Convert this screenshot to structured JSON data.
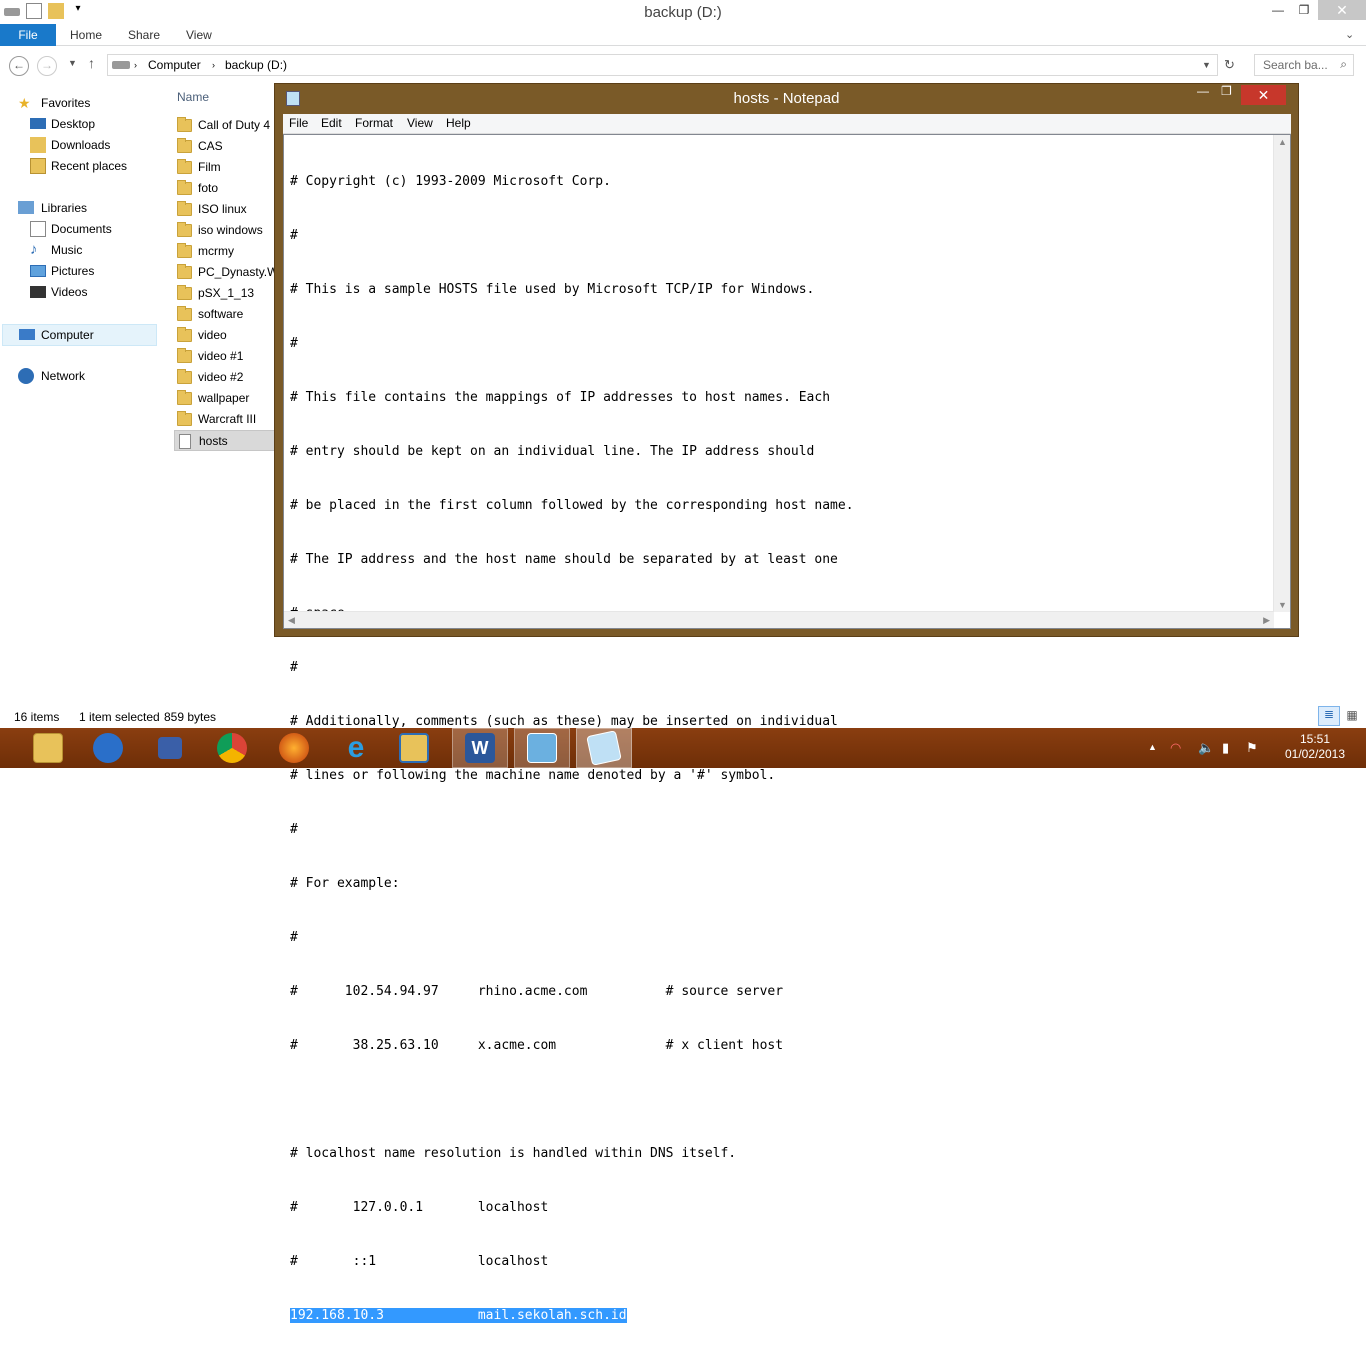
{
  "explorer": {
    "title": "backup (D:)",
    "ribbon_tabs": [
      "File",
      "Home",
      "Share",
      "View"
    ],
    "breadcrumb": [
      "Computer",
      "backup (D:)"
    ],
    "search_placeholder": "Search ba...",
    "column_header": "Name",
    "nav": {
      "favorites": "Favorites",
      "favorites_items": [
        "Desktop",
        "Downloads",
        "Recent places"
      ],
      "libraries": "Libraries",
      "libraries_items": [
        "Documents",
        "Music",
        "Pictures",
        "Videos"
      ],
      "computer": "Computer",
      "network": "Network"
    },
    "files": [
      "Call of Duty 4",
      "CAS",
      "Film",
      "foto",
      "ISO linux",
      "iso windows",
      "mcrmy",
      "PC_Dynasty.W",
      "pSX_1_13",
      "software",
      "video",
      "video #1",
      "video #2",
      "wallpaper",
      "Warcraft III",
      "hosts"
    ],
    "status": {
      "items": "16 items",
      "selected": "1 item selected",
      "size": "859 bytes"
    }
  },
  "notepad": {
    "title": "hosts - Notepad",
    "menu": [
      "File",
      "Edit",
      "Format",
      "View",
      "Help"
    ],
    "lines": [
      "# Copyright (c) 1993-2009 Microsoft Corp.",
      "#",
      "# This is a sample HOSTS file used by Microsoft TCP/IP for Windows.",
      "#",
      "# This file contains the mappings of IP addresses to host names. Each",
      "# entry should be kept on an individual line. The IP address should",
      "# be placed in the first column followed by the corresponding host name.",
      "# The IP address and the host name should be separated by at least one",
      "# space.",
      "#",
      "# Additionally, comments (such as these) may be inserted on individual",
      "# lines or following the machine name denoted by a '#' symbol.",
      "#",
      "# For example:",
      "#",
      "#      102.54.94.97     rhino.acme.com          # source server",
      "#       38.25.63.10     x.acme.com              # x client host",
      "",
      "# localhost name resolution is handled within DNS itself.",
      "#       127.0.0.1       localhost",
      "#       ::1             localhost"
    ],
    "selected_line": "192.168.10.3            mail.sekolah.sch.id"
  },
  "taskbar": {
    "apps": [
      "file-explorer",
      "browser-globe",
      "network-tool",
      "chrome",
      "firefox",
      "internet-explorer",
      "archive-tool",
      "word",
      "control-panel",
      "notepad"
    ],
    "time": "15:51",
    "date": "01/02/2013"
  },
  "colors": {
    "explorer_accent": "#1979ca",
    "notepad_frame": "#7a5a28",
    "taskbar": "#7a3409",
    "selection": "#3399ff"
  }
}
